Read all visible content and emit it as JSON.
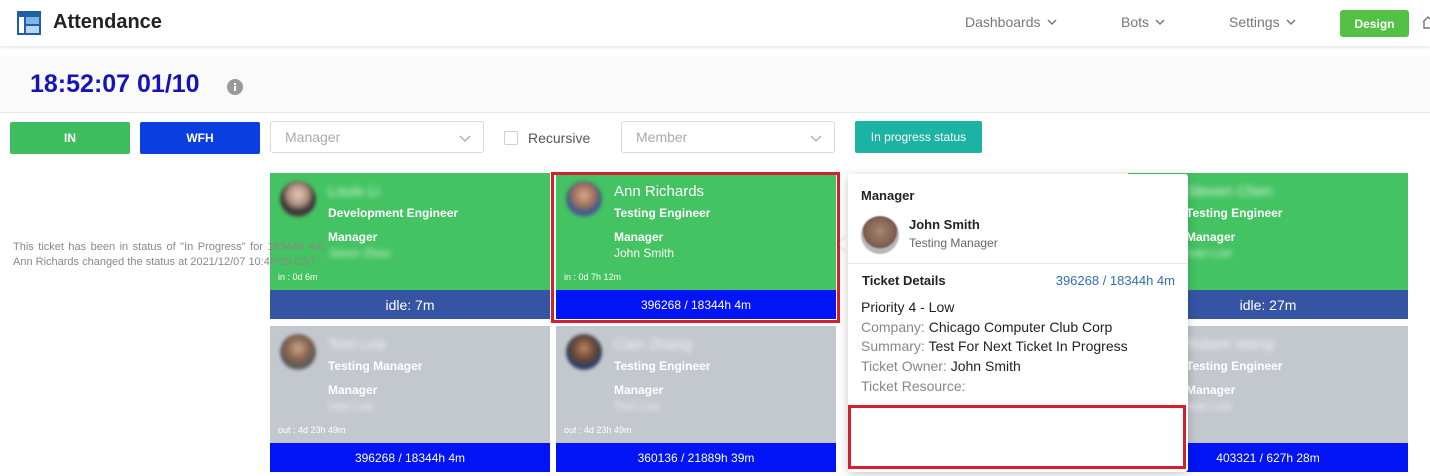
{
  "header": {
    "title": "Attendance",
    "nav": [
      {
        "label": "Dashboards"
      },
      {
        "label": "Bots"
      },
      {
        "label": "Settings"
      }
    ],
    "design_label": "Design"
  },
  "subheader": {
    "clock": "18:52:07 01/10"
  },
  "filters": {
    "in_label": "IN",
    "wfh_label": "WFH",
    "manager_placeholder": "Manager",
    "recursive_label": "Recursive",
    "member_placeholder": "Member",
    "status_label": "In progress status"
  },
  "cards": [
    {
      "name": "Louis Li",
      "role": "Development Engineer",
      "manager_label": "Manager",
      "manager": "Jason Zhao",
      "since": "in : 0d 6m",
      "bar": "idle: 7m"
    },
    {
      "name": "Ann Richards",
      "role": "Testing Engineer",
      "manager_label": "Manager",
      "manager": "John Smith",
      "since": "in : 0d 7h 12m",
      "bar": "396268 / 18344h 4m"
    },
    {
      "name": "Steven Chen",
      "role": "Testing Engineer",
      "manager_label": "Manager",
      "manager": "Ivan Lee",
      "since": "",
      "bar": "idle: 27m"
    },
    {
      "name": "Tom Lee",
      "role": "Testing Manager",
      "manager_label": "Manager",
      "manager": "Ivan Lee",
      "since": "out : 4d 23h 49m",
      "bar": "396268 / 18344h 4m"
    },
    {
      "name": "Cain Zhang",
      "role": "Testing Engineer",
      "manager_label": "Manager",
      "manager": "Tom Lee",
      "since": "out : 4d 23h 49m",
      "bar": "360136 / 21889h 39m"
    },
    {
      "name": "Robert Wang",
      "role": "Testing Engineer",
      "manager_label": "Manager",
      "manager": "Ivan Lee",
      "since": "",
      "bar": "403321 / 627h 28m"
    }
  ],
  "popover": {
    "title": "Manager",
    "manager_name": "John Smith",
    "manager_role": "Testing Manager",
    "ticket_title": "Ticket Details",
    "ticket_link": "396268 / 18344h 4m",
    "priority": "Priority 4 - Low",
    "company_key": "Company:",
    "company_val": "Chicago Computer Club Corp",
    "summary_key": "Summary:",
    "summary_val": "Test For Next Ticket In Progress",
    "owner_key": "Ticket Owner:",
    "owner_val": "John Smith",
    "resource_key": "Ticket Resource:",
    "note": "This ticket has been in status of \"In Progress\" for 18344h 4m. Ann Richards changed the status at 2021/12/07 10:46:05 CST"
  },
  "colors": {
    "green": "#43c361",
    "gray": "#c3c8ce",
    "idle_bar": "#3654a4",
    "ticket_bar": "#0014f5",
    "highlight": "#d41f2e",
    "clock": "#1414b8"
  }
}
